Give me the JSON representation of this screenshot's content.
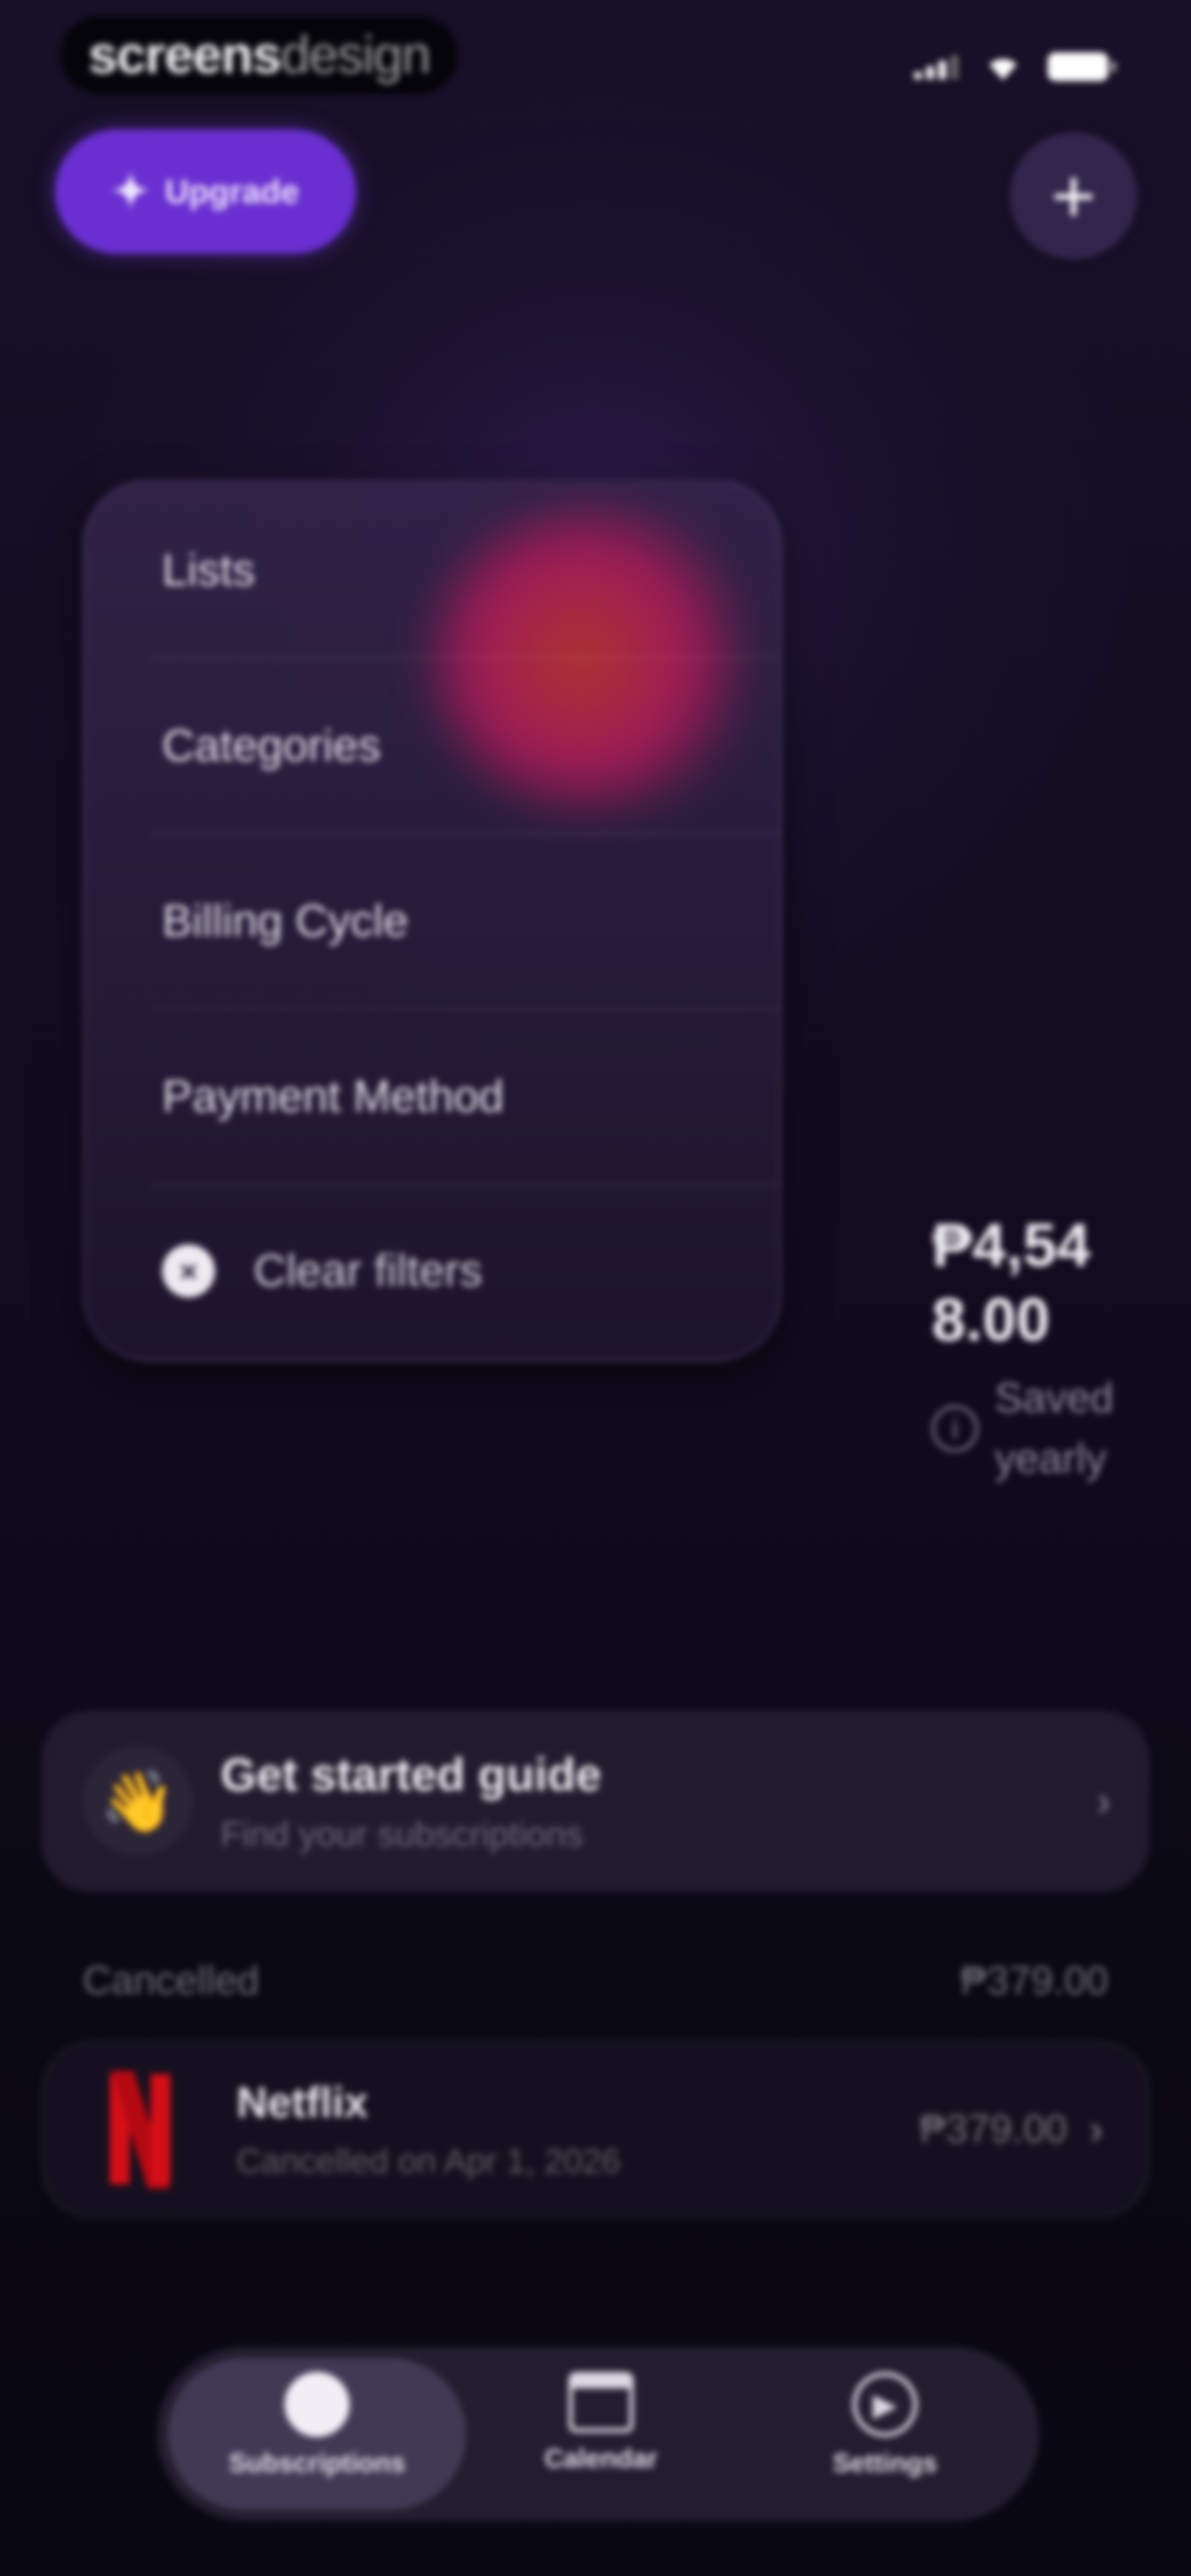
{
  "status_bar": {
    "brand_strong": "screens",
    "brand_light": "design"
  },
  "header": {
    "upgrade_label": "Upgrade",
    "upgrade_icon": "sparkle-icon",
    "add_icon": "plus-icon",
    "add_symbol": "+"
  },
  "filter_menu": {
    "items": [
      {
        "label": "Lists"
      },
      {
        "label": "Categories"
      },
      {
        "label": "Billing Cycle"
      },
      {
        "label": "Payment Method"
      }
    ],
    "clear_label": "Clear filters"
  },
  "savings": {
    "amount": "₱4,548.00",
    "label": "Saved yearly"
  },
  "guide": {
    "title": "Get started guide",
    "subtitle": "Find your subscriptions",
    "icon": "👋"
  },
  "cancelled": {
    "section_label": "Cancelled",
    "section_total": "₱379.00",
    "items": [
      {
        "name": "Netflix",
        "detail": "Cancelled on Apr 1, 2026",
        "price": "₱379.00"
      }
    ]
  },
  "tabs": [
    {
      "label": "Subscriptions",
      "active": true
    },
    {
      "label": "Calendar",
      "active": false
    },
    {
      "label": "Settings",
      "active": false
    }
  ],
  "colors": {
    "accent": "#6a2fd0",
    "background": "#0d0a17",
    "netflix_red": "#d50f18"
  }
}
